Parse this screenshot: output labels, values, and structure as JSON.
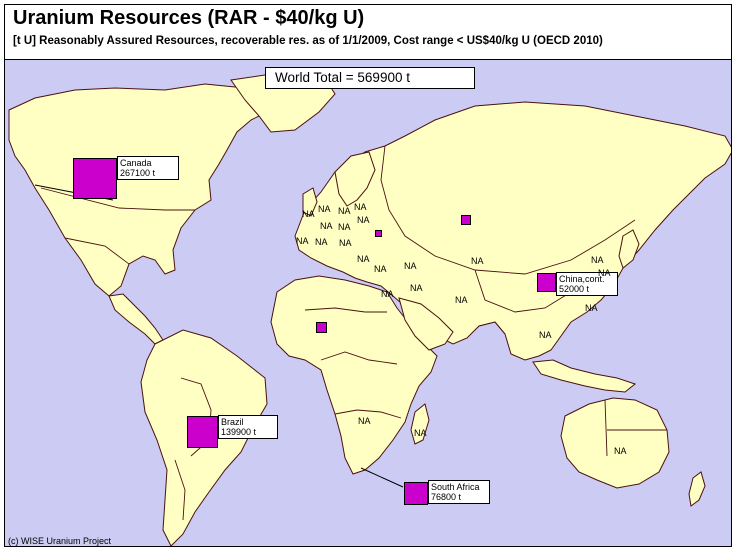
{
  "header": {
    "title": "Uranium Resources (RAR - $40/kg U)",
    "subtitle": "[t U] Reasonably Assured Resources, recoverable res. as of 1/1/2009, Cost range < US$40/kg U  (OECD 2010)"
  },
  "world_total": "World Total = 569900 t",
  "credit": "(c) WISE Uranium Project",
  "marker_color": "#cc00cc",
  "land_color": "#ffffc4",
  "sea_color": "#cbcbf4",
  "callouts": [
    {
      "name": "Canada",
      "value": "267100 t",
      "tonnes": 267100
    },
    {
      "name": "Brazil",
      "value": "139900 t",
      "tonnes": 139900
    },
    {
      "name": "South Africa",
      "value": "76800 t",
      "tonnes": 76800
    },
    {
      "name": "China,cont.",
      "value": "52000 t",
      "tonnes": 52000
    }
  ],
  "unlabeled_markers": [
    "Kazakhstan",
    "Niger",
    "Ukraine"
  ],
  "na_label": "NA"
}
